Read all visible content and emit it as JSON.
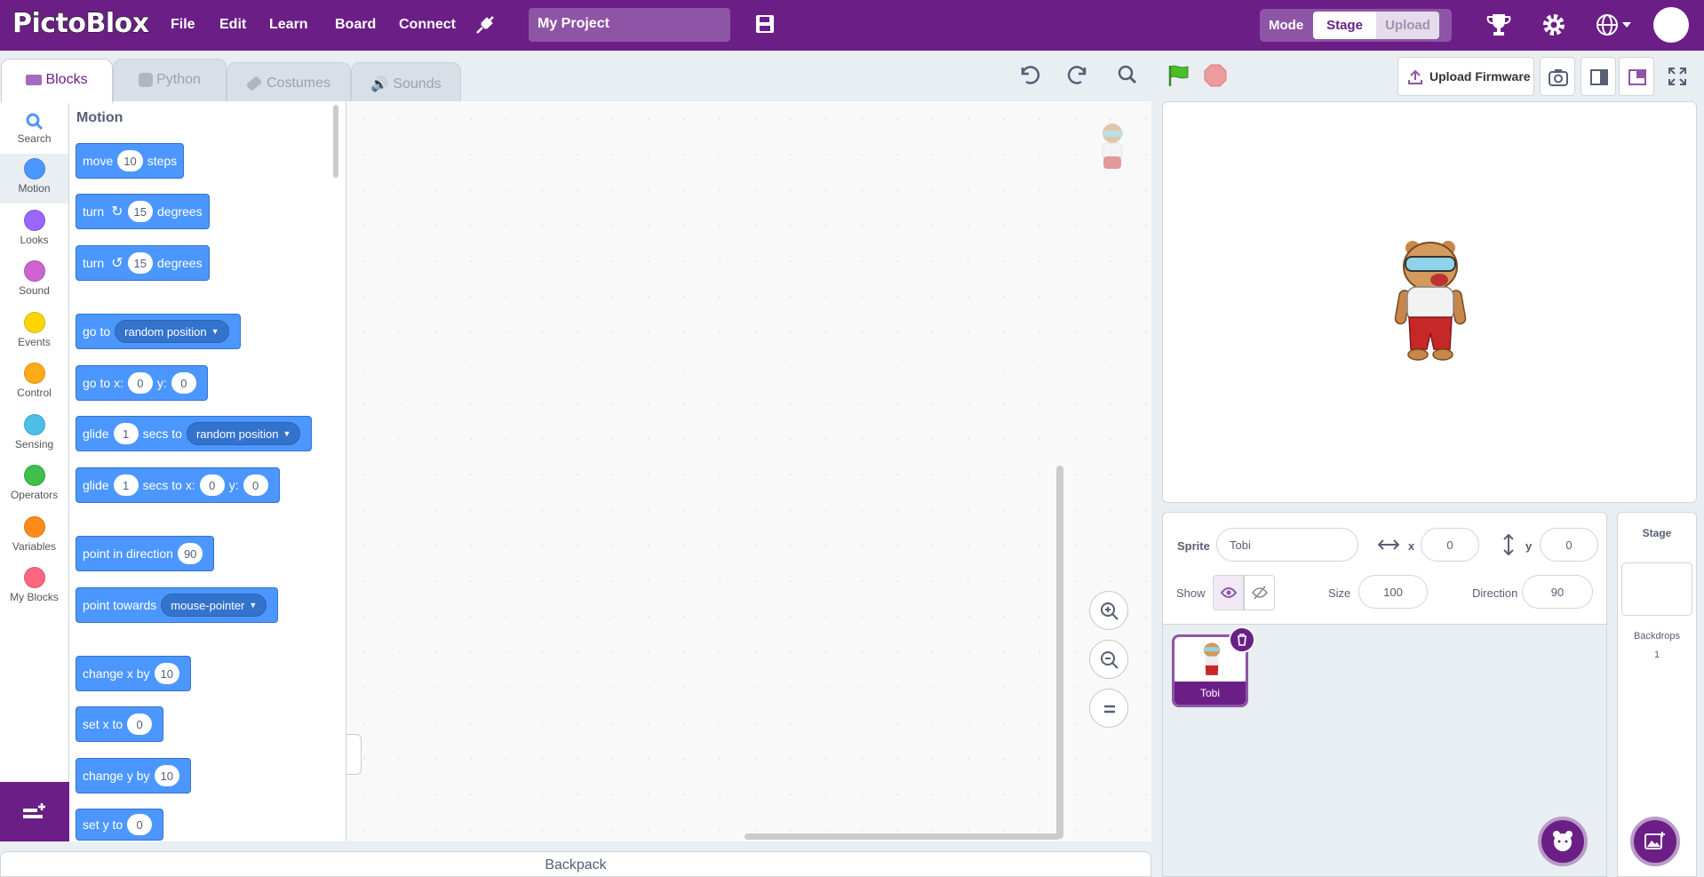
{
  "app": {
    "logo": "PictoBlox",
    "project_name": "My Project"
  },
  "menu": {
    "file": "File",
    "edit": "Edit",
    "learn": "Learn",
    "board": "Board",
    "connect": "Connect"
  },
  "mode": {
    "label": "Mode",
    "stage": "Stage",
    "upload": "Upload"
  },
  "tabs": {
    "blocks": "Blocks",
    "python": "Python",
    "costumes": "Costumes",
    "sounds": "Sounds"
  },
  "categories": [
    {
      "label": "Search",
      "color": "#4c97ff"
    },
    {
      "label": "Motion",
      "color": "#4c97ff"
    },
    {
      "label": "Looks",
      "color": "#9966ff"
    },
    {
      "label": "Sound",
      "color": "#cf63cf"
    },
    {
      "label": "Events",
      "color": "#ffd500"
    },
    {
      "label": "Control",
      "color": "#ffab19"
    },
    {
      "label": "Sensing",
      "color": "#4cbfe6"
    },
    {
      "label": "Operators",
      "color": "#40bf4a"
    },
    {
      "label": "Variables",
      "color": "#ff8c1a"
    },
    {
      "label": "My Blocks",
      "color": "#ff6680"
    }
  ],
  "palette": {
    "title": "Motion",
    "move": {
      "a": "move",
      "v": "10",
      "b": "steps"
    },
    "turn_cw": {
      "a": "turn",
      "v": "15",
      "b": "degrees"
    },
    "turn_ccw": {
      "a": "turn",
      "v": "15",
      "b": "degrees"
    },
    "goto": {
      "a": "go to",
      "dd": "random position"
    },
    "gotoxy": {
      "a": "go to x:",
      "x": "0",
      "b": "y:",
      "y": "0"
    },
    "glide_to": {
      "a": "glide",
      "v": "1",
      "b": "secs to",
      "dd": "random position"
    },
    "glide_xy": {
      "a": "glide",
      "v": "1",
      "b": "secs to x:",
      "x": "0",
      "c": "y:",
      "y": "0"
    },
    "point_dir": {
      "a": "point in direction",
      "v": "90"
    },
    "point_towards": {
      "a": "point towards",
      "dd": "mouse-pointer"
    },
    "change_x": {
      "a": "change x by",
      "v": "10"
    },
    "set_x": {
      "a": "set x to",
      "v": "0"
    },
    "change_y": {
      "a": "change y by",
      "v": "10"
    },
    "set_y": {
      "a": "set y to",
      "v": "0"
    }
  },
  "workspace": {
    "backpack": "Backpack"
  },
  "toolbar": {
    "upload_firmware": "Upload Firmware"
  },
  "sprite": {
    "label": "Sprite",
    "name": "Tobi",
    "x_label": "x",
    "x": "0",
    "y_label": "y",
    "y": "0",
    "show_label": "Show",
    "size_label": "Size",
    "size": "100",
    "direction_label": "Direction",
    "direction": "90",
    "thumb_name": "Tobi"
  },
  "stage_panel": {
    "title": "Stage",
    "backdrops_label": "Backdrops",
    "backdrops_count": "1"
  },
  "colors": {
    "brand": "#6b1f86",
    "block_motion": "#4c97ff"
  }
}
